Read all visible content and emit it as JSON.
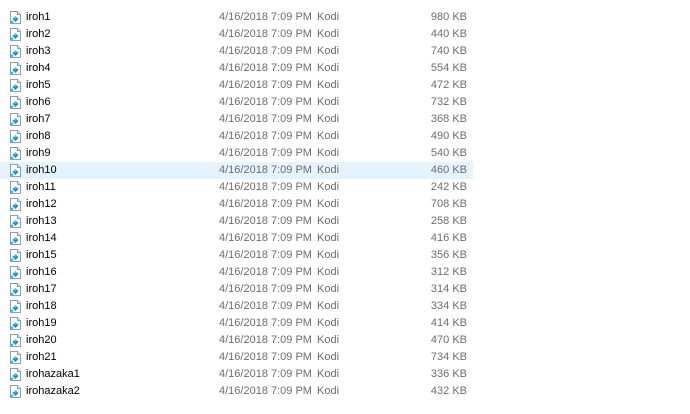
{
  "files": [
    {
      "name": "iroh1",
      "date": "4/16/2018 7:09 PM",
      "type": "Kodi",
      "size": "980 KB"
    },
    {
      "name": "iroh2",
      "date": "4/16/2018 7:09 PM",
      "type": "Kodi",
      "size": "440 KB"
    },
    {
      "name": "iroh3",
      "date": "4/16/2018 7:09 PM",
      "type": "Kodi",
      "size": "740 KB"
    },
    {
      "name": "iroh4",
      "date": "4/16/2018 7:09 PM",
      "type": "Kodi",
      "size": "554 KB"
    },
    {
      "name": "iroh5",
      "date": "4/16/2018 7:09 PM",
      "type": "Kodi",
      "size": "472 KB"
    },
    {
      "name": "iroh6",
      "date": "4/16/2018 7:09 PM",
      "type": "Kodi",
      "size": "732 KB"
    },
    {
      "name": "iroh7",
      "date": "4/16/2018 7:09 PM",
      "type": "Kodi",
      "size": "368 KB"
    },
    {
      "name": "iroh8",
      "date": "4/16/2018 7:09 PM",
      "type": "Kodi",
      "size": "490 KB"
    },
    {
      "name": "iroh9",
      "date": "4/16/2018 7:09 PM",
      "type": "Kodi",
      "size": "540 KB"
    },
    {
      "name": "iroh10",
      "date": "4/16/2018 7:09 PM",
      "type": "Kodi",
      "size": "460 KB",
      "hover": true
    },
    {
      "name": "iroh11",
      "date": "4/16/2018 7:09 PM",
      "type": "Kodi",
      "size": "242 KB"
    },
    {
      "name": "iroh12",
      "date": "4/16/2018 7:09 PM",
      "type": "Kodi",
      "size": "708 KB"
    },
    {
      "name": "iroh13",
      "date": "4/16/2018 7:09 PM",
      "type": "Kodi",
      "size": "258 KB"
    },
    {
      "name": "iroh14",
      "date": "4/16/2018 7:09 PM",
      "type": "Kodi",
      "size": "416 KB"
    },
    {
      "name": "iroh15",
      "date": "4/16/2018 7:09 PM",
      "type": "Kodi",
      "size": "356 KB"
    },
    {
      "name": "iroh16",
      "date": "4/16/2018 7:09 PM",
      "type": "Kodi",
      "size": "312 KB"
    },
    {
      "name": "iroh17",
      "date": "4/16/2018 7:09 PM",
      "type": "Kodi",
      "size": "314 KB"
    },
    {
      "name": "iroh18",
      "date": "4/16/2018 7:09 PM",
      "type": "Kodi",
      "size": "334 KB"
    },
    {
      "name": "iroh19",
      "date": "4/16/2018 7:09 PM",
      "type": "Kodi",
      "size": "414 KB"
    },
    {
      "name": "iroh20",
      "date": "4/16/2018 7:09 PM",
      "type": "Kodi",
      "size": "470 KB"
    },
    {
      "name": "iroh21",
      "date": "4/16/2018 7:09 PM",
      "type": "Kodi",
      "size": "734 KB"
    },
    {
      "name": "irohazaka1",
      "date": "4/16/2018 7:09 PM",
      "type": "Kodi",
      "size": "336 KB"
    },
    {
      "name": "irohazaka2",
      "date": "4/16/2018 7:09 PM",
      "type": "Kodi",
      "size": "432 KB"
    }
  ],
  "file_icon": "kodi-file-icon",
  "colors": {
    "hover_background": "#e5f3ff",
    "icon_blue": "#1a8fd6",
    "secondary_text": "#6d6d6d"
  }
}
